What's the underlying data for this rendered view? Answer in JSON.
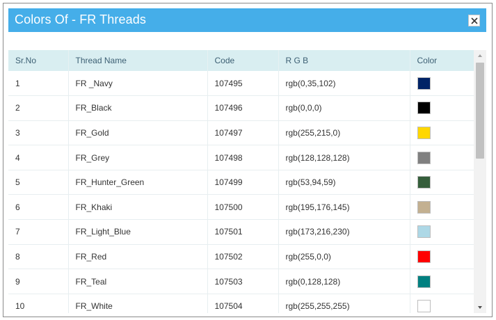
{
  "dialog": {
    "title": "Colors Of - FR Threads",
    "close_label": "×"
  },
  "table": {
    "headers": [
      "Sr.No",
      "Thread Name",
      "Code",
      "R G B",
      "Color"
    ],
    "rows": [
      {
        "sr": "1",
        "name": "FR _Navy",
        "code": "107495",
        "rgb": "rgb(0,35,102)",
        "color": "#002366"
      },
      {
        "sr": "2",
        "name": "FR_Black",
        "code": "107496",
        "rgb": "rgb(0,0,0)",
        "color": "#000000"
      },
      {
        "sr": "3",
        "name": "FR_Gold",
        "code": "107497",
        "rgb": "rgb(255,215,0)",
        "color": "#ffd700"
      },
      {
        "sr": "4",
        "name": "FR_Grey",
        "code": "107498",
        "rgb": "rgb(128,128,128)",
        "color": "#808080"
      },
      {
        "sr": "5",
        "name": "FR_Hunter_Green",
        "code": "107499",
        "rgb": "rgb(53,94,59)",
        "color": "#355e3b"
      },
      {
        "sr": "6",
        "name": "FR_Khaki",
        "code": "107500",
        "rgb": "rgb(195,176,145)",
        "color": "#c3b091"
      },
      {
        "sr": "7",
        "name": "FR_Light_Blue",
        "code": "107501",
        "rgb": "rgb(173,216,230)",
        "color": "#add8e6"
      },
      {
        "sr": "8",
        "name": "FR_Red",
        "code": "107502",
        "rgb": "rgb(255,0,0)",
        "color": "#ff0000"
      },
      {
        "sr": "9",
        "name": "FR_Teal",
        "code": "107503",
        "rgb": "rgb(0,128,128)",
        "color": "#008080"
      },
      {
        "sr": "10",
        "name": "FR_White",
        "code": "107504",
        "rgb": "rgb(255,255,255)",
        "color": "#ffffff"
      }
    ]
  },
  "colors": {
    "title_bar": "#45aee9",
    "header_bg": "#d9eef1"
  },
  "icons": {
    "close": "close-icon",
    "scroll_up": "triangle-up-icon",
    "scroll_down": "triangle-down-icon"
  }
}
